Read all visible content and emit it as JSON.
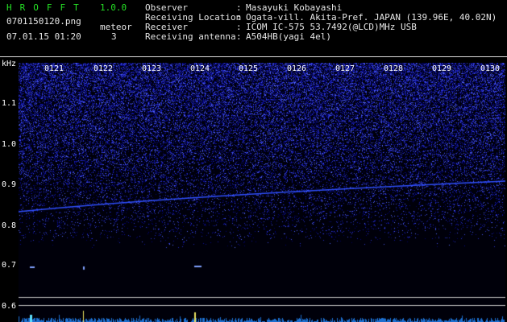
{
  "app": {
    "title": "HROFFT",
    "version": "1.0.0"
  },
  "file": {
    "name": "0701150120.png",
    "timestamp": "07.01.15 01:20"
  },
  "meteor": {
    "label": "meteor",
    "count": "3"
  },
  "meta": [
    {
      "key": "Observer",
      "value": "Masayuki Kobayashi"
    },
    {
      "key": "Receiving Location",
      "value": "Ogata-vill. Akita-Pref. JAPAN (139.96E, 40.02N)"
    },
    {
      "key": "Receiver",
      "value": "ICOM IC-575 53.7492(@LCD)MHz USB"
    },
    {
      "key": "Receiving antenna",
      "value": "A504HB(yagi 4el)"
    }
  ],
  "axis": {
    "unit": "kHz",
    "ticks": [
      "1.1",
      "1.0",
      "0.9",
      "0.8",
      "0.7",
      "0.6"
    ],
    "minutes": [
      "0121",
      "0122",
      "0123",
      "0124",
      "0125",
      "0126",
      "0127",
      "0128",
      "0129",
      "0130"
    ]
  },
  "colors": {
    "accent_green": "#25e025",
    "signal_blue": "#3050ff",
    "noise_blue": "#2040c0"
  }
}
